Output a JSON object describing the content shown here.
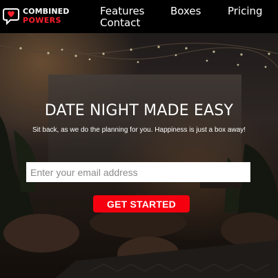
{
  "brand": {
    "line1": "COMBINED",
    "line2": "POWERS",
    "icon": "speech-bubble-heart-icon",
    "accent_color": "#ff1f2d"
  },
  "nav": {
    "items": [
      {
        "label": "Features"
      },
      {
        "label": "Boxes"
      },
      {
        "label": "Pricing"
      },
      {
        "label": "Contact"
      }
    ]
  },
  "hero": {
    "title": "DATE NIGHT MADE EASY",
    "subtitle": "Sit back, as we do the planning for you. Happiness is just a box away!",
    "email_placeholder": "Enter your email address",
    "cta_label": "GET STARTED",
    "cta_color": "#f5000f"
  }
}
